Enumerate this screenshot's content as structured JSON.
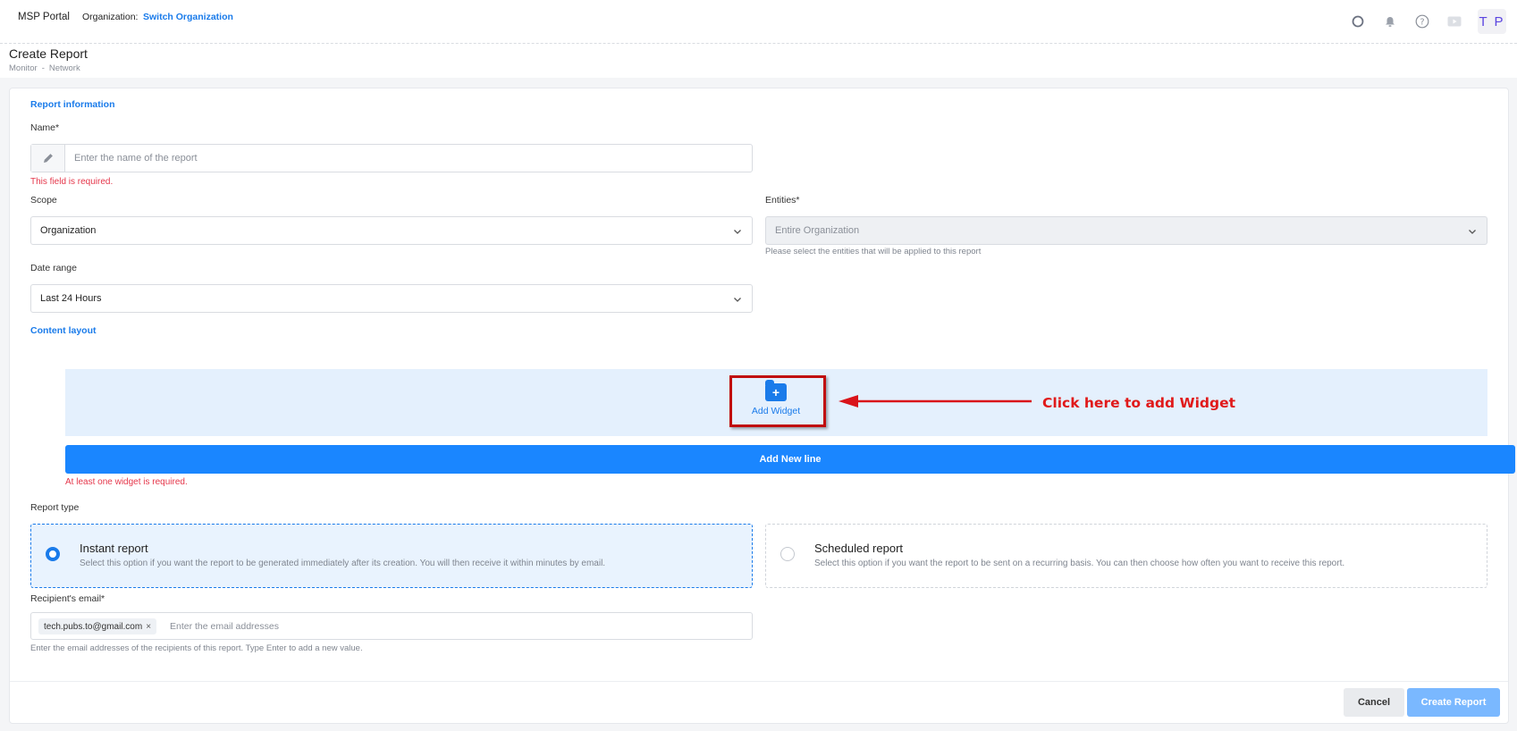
{
  "header": {
    "brand": "MSP Portal",
    "org_label": "Organization:",
    "org_link": "Switch Organization",
    "avatar_initials": "T P",
    "icons": [
      "circle-status-icon",
      "bell-icon",
      "help-icon",
      "video-icon"
    ]
  },
  "page": {
    "title": "Create Report",
    "breadcrumb": [
      "Monitor",
      "Network"
    ],
    "breadcrumb_sep": "-"
  },
  "report_info": {
    "section_title": "Report information",
    "name_label": "Name*",
    "name_placeholder": "Enter the name of the report",
    "name_error": "This field is required.",
    "scope_label": "Scope",
    "scope_value": "Organization",
    "entities_label": "Entities*",
    "entities_value": "Entire Organization",
    "entities_hint": "Please select the entities that will be applied to this report",
    "date_range_label": "Date range",
    "date_range_value": "Last 24 Hours"
  },
  "content_layout": {
    "section_title": "Content layout",
    "add_widget_label": "Add Widget",
    "add_widget_icon": "+",
    "add_line_label": "Add New line",
    "widget_error": "At least one widget is required.",
    "annotation": "Click here to add Widget"
  },
  "report_type": {
    "label": "Report type",
    "options": [
      {
        "title": "Instant report",
        "description": "Select this option if you want the report to be generated immediately after its creation. You will then receive it within minutes by email.",
        "selected": true
      },
      {
        "title": "Scheduled report",
        "description": "Select this option if you want the report to be sent on a recurring basis. You can then choose how often you want to receive this report.",
        "selected": false
      }
    ]
  },
  "recipients": {
    "label": "Recipient's email*",
    "chips": [
      "tech.pubs.to@gmail.com"
    ],
    "chip_remove": "×",
    "placeholder": "Enter the email addresses",
    "hint": "Enter the email addresses of the recipients of this report. Type Enter to add a new value."
  },
  "footer": {
    "cancel_label": "Cancel",
    "create_label": "Create Report"
  },
  "colors": {
    "accent": "#1a7bea",
    "error": "#e5374b",
    "annotation": "#e01a1a"
  }
}
